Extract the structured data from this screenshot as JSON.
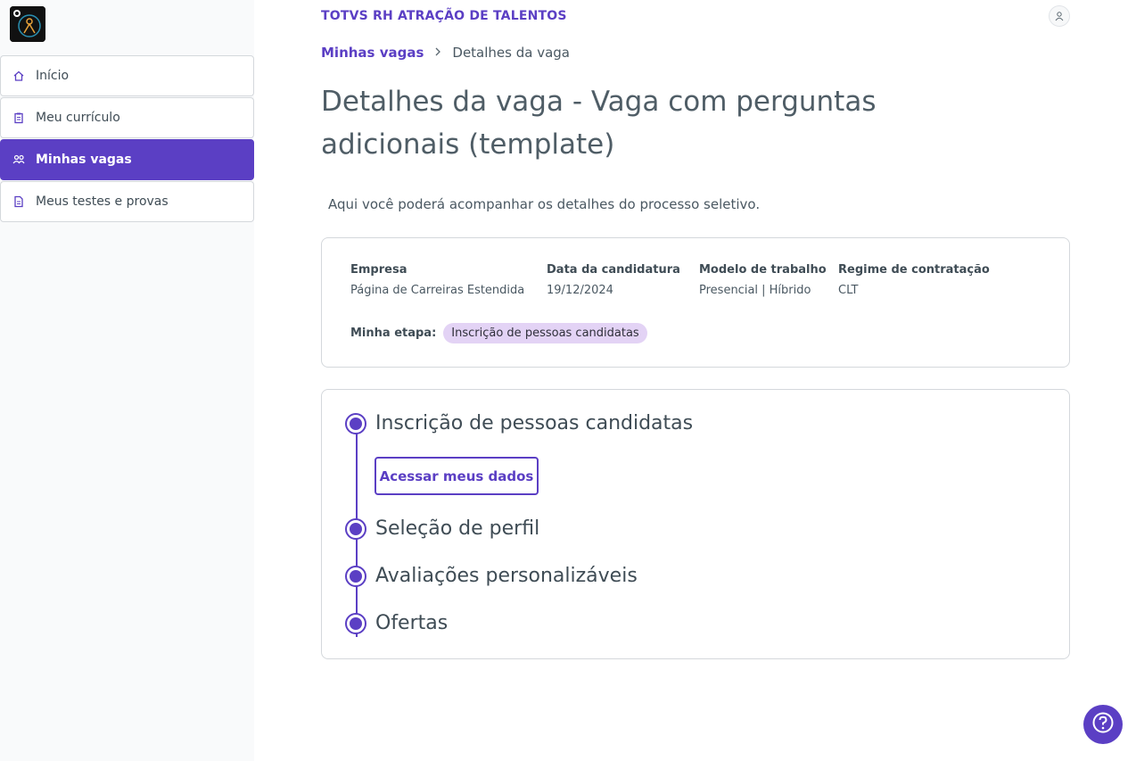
{
  "sidebar": {
    "items": [
      {
        "label": "Início",
        "icon": "home-icon"
      },
      {
        "label": "Meu currículo",
        "icon": "clipboard-icon"
      },
      {
        "label": "Minhas vagas",
        "icon": "people-icon",
        "active": true
      },
      {
        "label": "Meus testes e provas",
        "icon": "document-icon"
      }
    ]
  },
  "header": {
    "brand": "TOTVS RH ATRAÇÃO DE TALENTOS",
    "user_icon": "user-icon"
  },
  "breadcrumb": {
    "link": "Minhas vagas",
    "current": "Detalhes da vaga"
  },
  "page": {
    "title": "Detalhes da vaga - Vaga com perguntas adicionais (template)",
    "intro": "Aqui você poderá acompanhar os detalhes do processo seletivo."
  },
  "info": {
    "columns": [
      {
        "label": "Empresa",
        "value": "Página de Carreiras Estendida"
      },
      {
        "label": "Data da candidatura",
        "value": "19/12/2024"
      },
      {
        "label": "Modelo de trabalho",
        "value": "Presencial | Híbrido"
      },
      {
        "label": "Regime de contratação",
        "value": "CLT"
      }
    ],
    "stage_label": "Minha etapa:",
    "stage_value": "Inscrição de pessoas candidatas"
  },
  "timeline": {
    "steps": [
      {
        "title": "Inscrição de pessoas candidatas"
      },
      {
        "title": "Seleção de perfil"
      },
      {
        "title": "Avaliações personalizáveis"
      },
      {
        "title": "Ofertas"
      }
    ],
    "button_label": "Acessar meus dados"
  },
  "colors": {
    "accent": "#5b3fc4",
    "badge": "#e3d3f5"
  },
  "help_icon": "help-icon"
}
